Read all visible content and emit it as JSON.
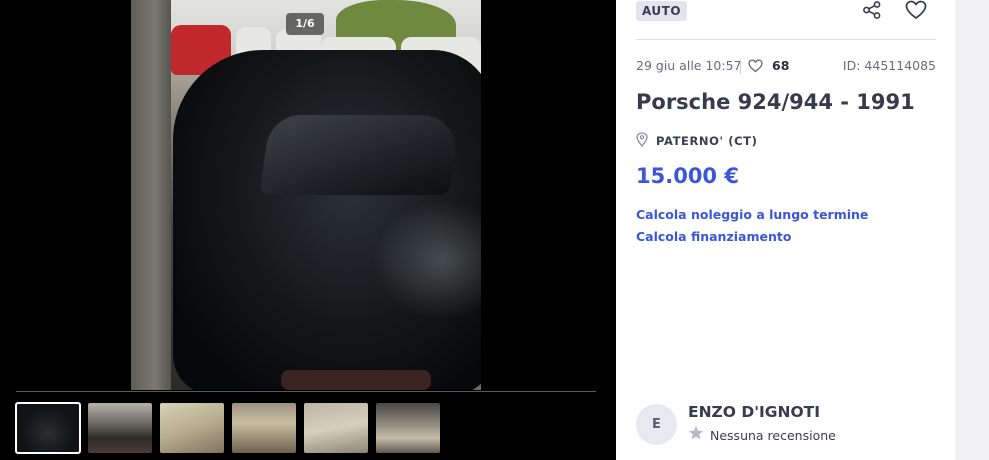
{
  "gallery": {
    "counter": "1/6",
    "thumbnails": [
      {
        "name": "thumb-1",
        "active": true
      },
      {
        "name": "thumb-2",
        "active": false
      },
      {
        "name": "thumb-3",
        "active": false
      },
      {
        "name": "thumb-4",
        "active": false
      },
      {
        "name": "thumb-5",
        "active": false
      },
      {
        "name": "thumb-6",
        "active": false
      }
    ]
  },
  "listing": {
    "category": "AUTO",
    "date": "29 giu alle 10:57",
    "favorites_count": "68",
    "ad_id": "ID: 445114085",
    "title": "Porsche 924/944 - 1991",
    "location": "PATERNO' (CT)",
    "price": "15.000 €",
    "link_rental": "Calcola noleggio a lungo termine",
    "link_financing": "Calcola finanziamento"
  },
  "seller": {
    "avatar_initial": "E",
    "name": "ENZO D'IGNOTI",
    "reviews": "Nessuna recensione"
  },
  "icons": {
    "share": "share-icon",
    "favorite": "heart-icon",
    "location": "location-pin-icon",
    "star": "star-icon"
  },
  "colors": {
    "accent": "#3b56d9",
    "text": "#3a3a4e",
    "muted": "#6b6b7f"
  }
}
